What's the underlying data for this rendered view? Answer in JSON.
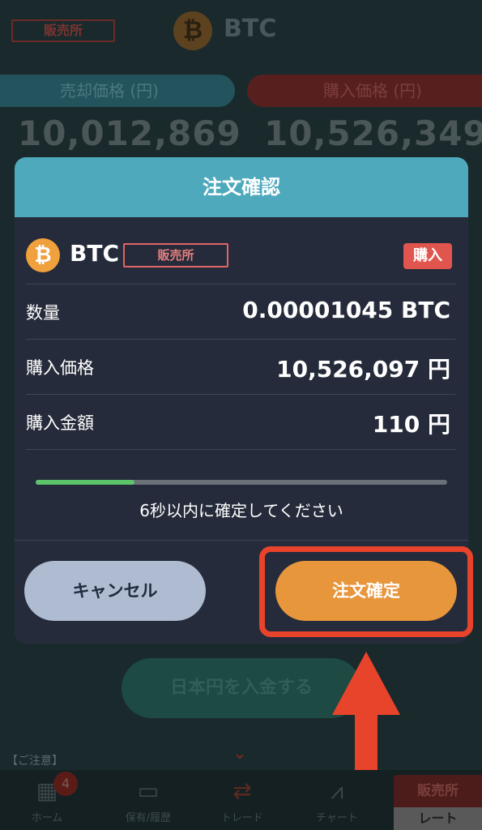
{
  "header": {
    "exchange_tag": "販売所",
    "coin_symbol": "BTC",
    "coin_glyph": "₿",
    "sell_label": "売却価格 (円)",
    "buy_label": "購入価格 (円)",
    "sell_price": "10,012,869",
    "buy_price": "10,526,349"
  },
  "modal": {
    "title": "注文確認",
    "coin_glyph": "₿",
    "coin_symbol": "BTC",
    "exchange_badge": "販売所",
    "side_badge": "購入",
    "rows": [
      {
        "label": "数量",
        "value": "0.00001045 BTC"
      },
      {
        "label": "購入価格",
        "value": "10,526,097 円"
      },
      {
        "label": "購入金額",
        "value": "110 円"
      }
    ],
    "progress": 0.24,
    "countdown_text": "6秒以内に確定してください",
    "cancel_label": "キャンセル",
    "confirm_label": "注文確定"
  },
  "background": {
    "deposit_label": "日本円を入金する",
    "notice": "【ご注意】"
  },
  "bottom_nav": {
    "items": [
      {
        "label": "ホーム",
        "icon": "grid-icon"
      },
      {
        "label": "保有/履歴",
        "icon": "wallet-icon"
      },
      {
        "label": "トレード",
        "icon": "exchange-arrows-icon"
      },
      {
        "label": "チャート",
        "icon": "chart-icon"
      }
    ],
    "home_badge": "4",
    "mode_top": "販売所",
    "mode_bottom": "レート"
  },
  "colors": {
    "accent": "#4ea9bd",
    "confirm": "#e8963c",
    "buy_red": "#e0564f",
    "progress_green": "#5cc46b",
    "annotation": "#e8432b"
  }
}
